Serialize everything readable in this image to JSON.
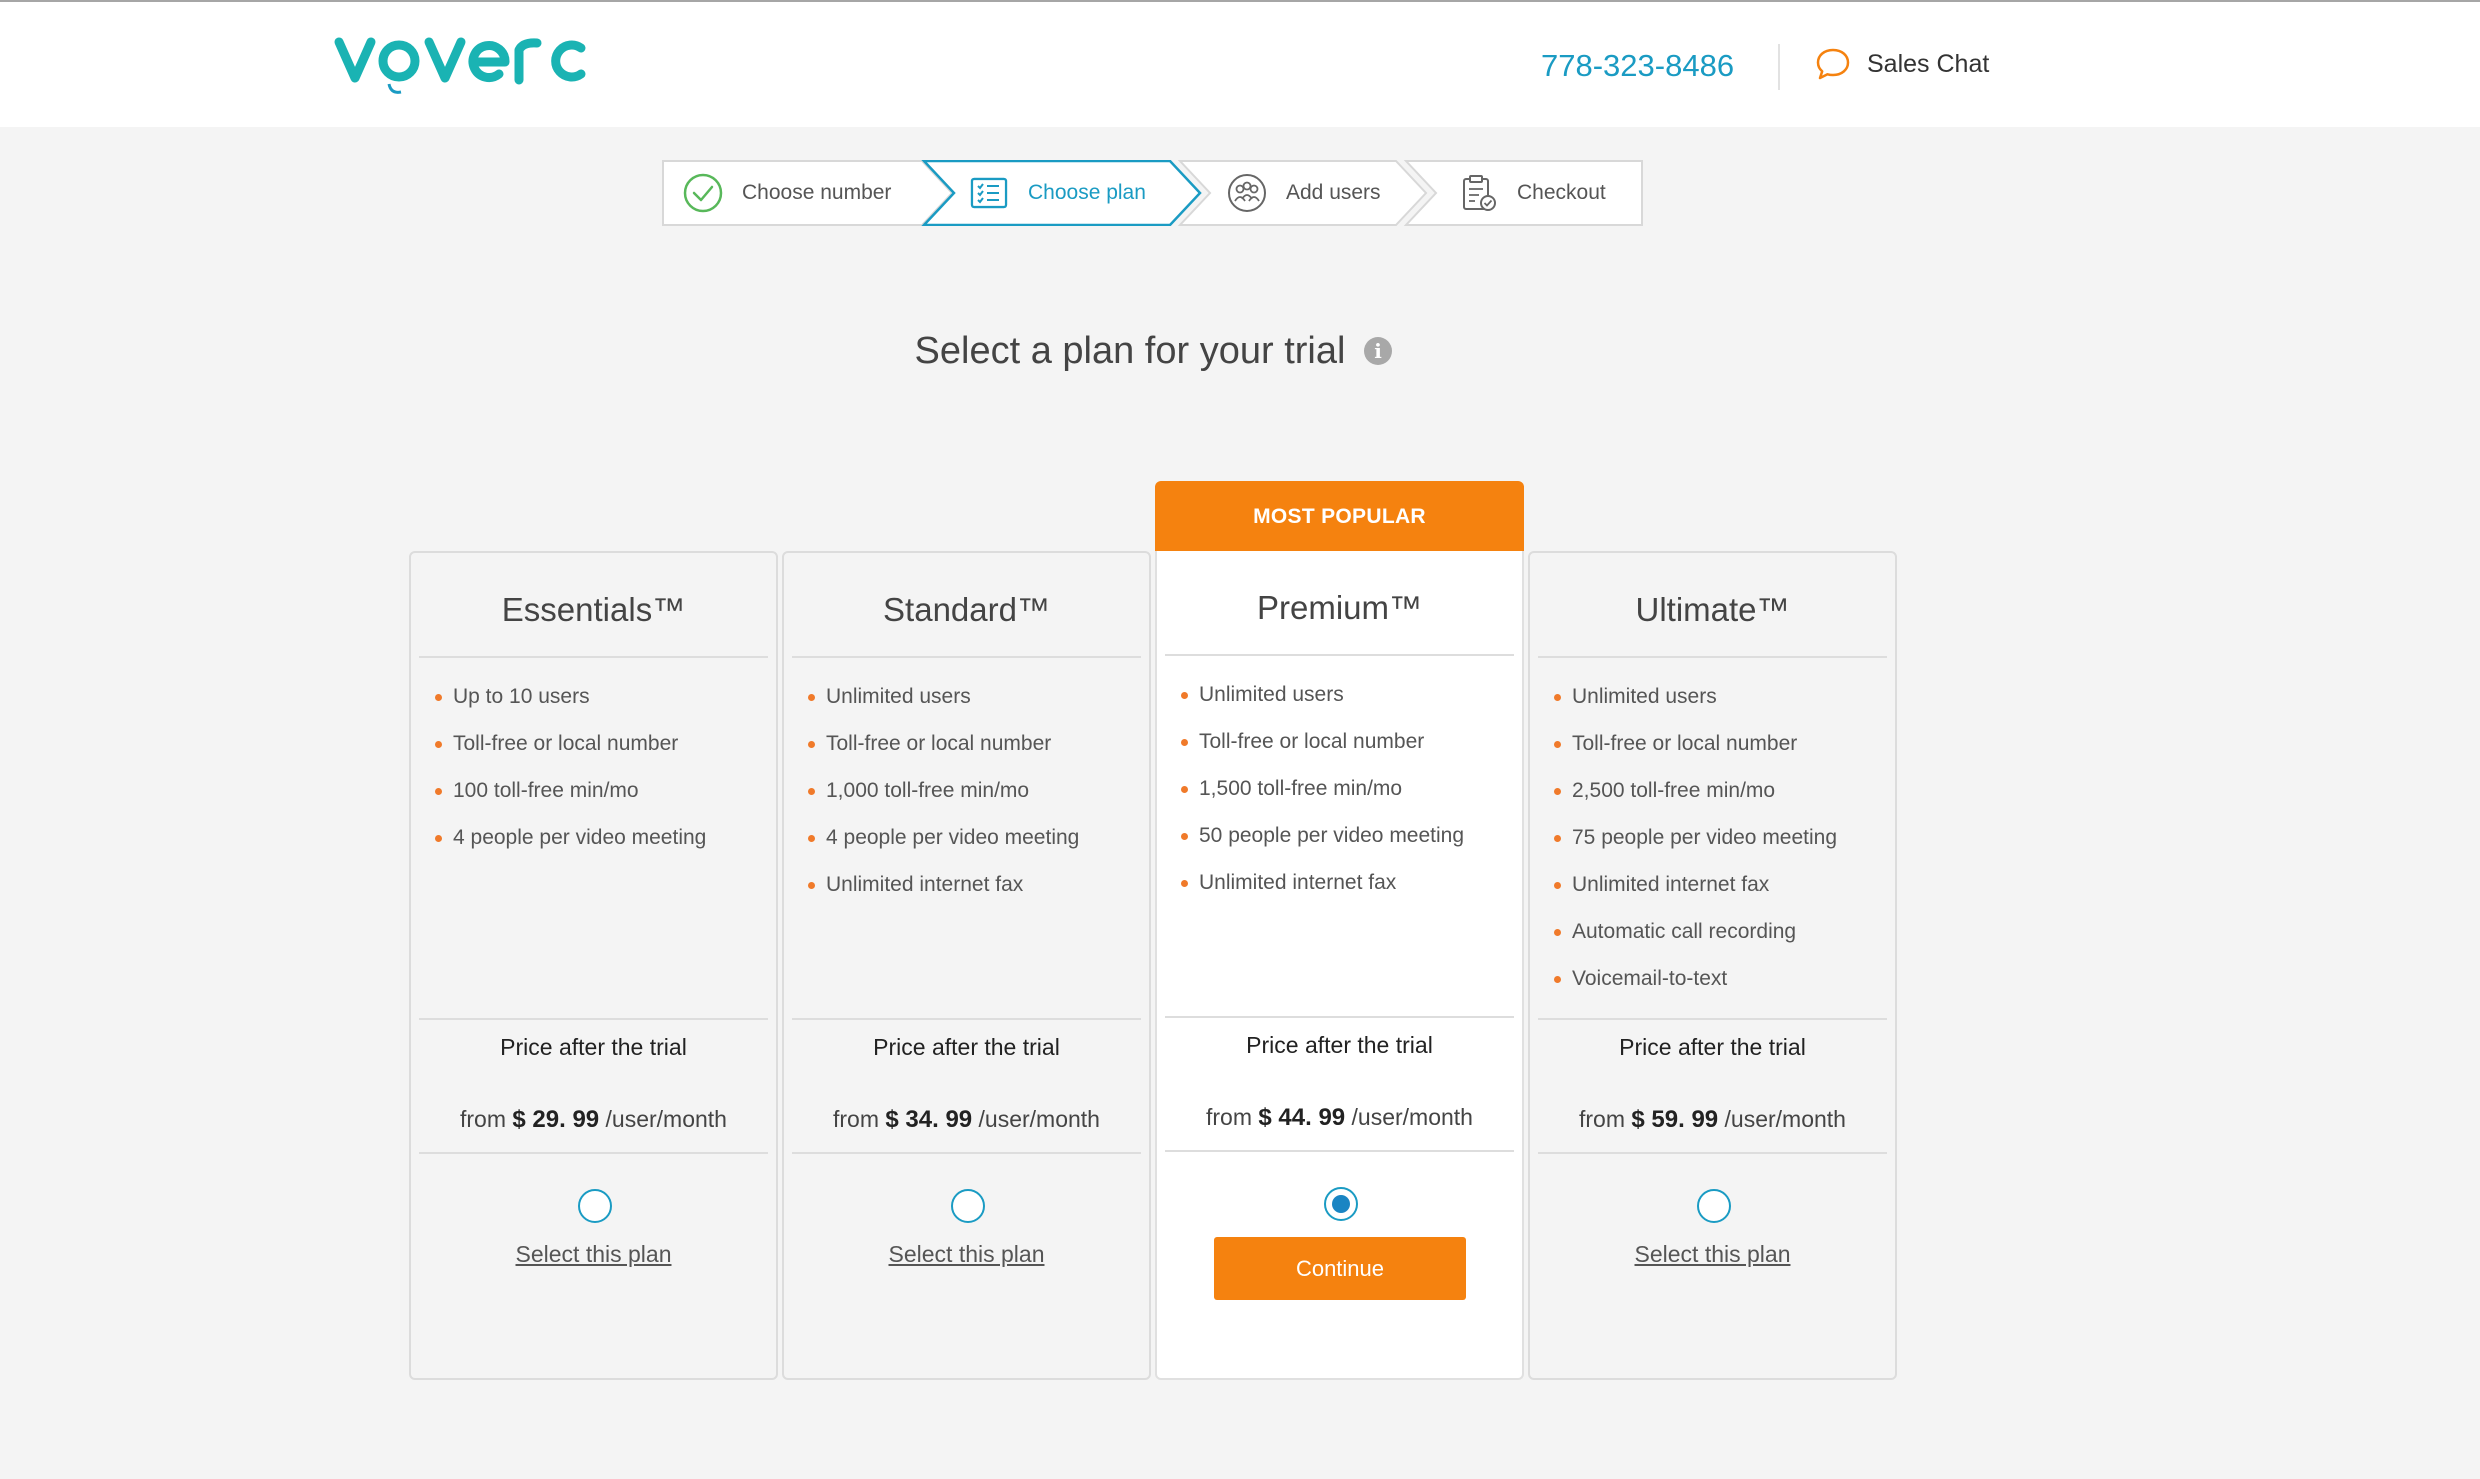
{
  "header": {
    "phone": "778-323-8486",
    "sales_chat_label": "Sales Chat",
    "logo_text": "voverc"
  },
  "stepper": {
    "steps": [
      {
        "label": "Choose number",
        "icon": "check-circle-icon",
        "state": "completed"
      },
      {
        "label": "Choose plan",
        "icon": "plan-list-icon",
        "state": "active"
      },
      {
        "label": "Add users",
        "icon": "users-group-icon",
        "state": "upcoming"
      },
      {
        "label": "Checkout",
        "icon": "clipboard-check-icon",
        "state": "upcoming"
      }
    ]
  },
  "page": {
    "title": "Select a plan for your trial",
    "info_icon_label": "i"
  },
  "badge": "MOST POPULAR",
  "plans": [
    {
      "name": "Essentials™",
      "features": [
        "Up to 10 users",
        "Toll-free or local number",
        "100 toll-free min/mo",
        "4 people per video meeting"
      ],
      "price_label": "Price after the trial",
      "price_prefix": "from",
      "price": "$ 29. 99",
      "price_suffix": "/user/month",
      "selected": false,
      "action_label": "Select this plan"
    },
    {
      "name": "Standard™",
      "features": [
        "Unlimited users",
        "Toll-free or local number",
        "1,000 toll-free min/mo",
        "4 people per video meeting",
        "Unlimited internet fax"
      ],
      "price_label": "Price after the trial",
      "price_prefix": "from",
      "price": "$ 34. 99",
      "price_suffix": "/user/month",
      "selected": false,
      "action_label": "Select this plan"
    },
    {
      "name": "Premium™",
      "features": [
        "Unlimited users",
        "Toll-free or local number",
        "1,500 toll-free min/mo",
        "50 people per video meeting",
        "Unlimited internet fax"
      ],
      "price_label": "Price after the trial",
      "price_prefix": "from",
      "price": "$ 44. 99",
      "price_suffix": "/user/month",
      "selected": true,
      "action_label": "Continue"
    },
    {
      "name": "Ultimate™",
      "features": [
        "Unlimited users",
        "Toll-free or local number",
        "2,500 toll-free min/mo",
        "75 people per video meeting",
        "Unlimited internet fax",
        "Automatic call recording",
        "Voicemail-to-text"
      ],
      "price_label": "Price after the trial",
      "price_prefix": "from",
      "price": "$ 59. 99",
      "price_suffix": "/user/month",
      "selected": false,
      "action_label": "Select this plan"
    }
  ],
  "colors": {
    "brand_teal": "#1ab3b3",
    "link_blue": "#1a9bc3",
    "accent_orange": "#f5820f",
    "bullet_orange": "#f07a2a",
    "page_bg": "#f4f4f4"
  }
}
